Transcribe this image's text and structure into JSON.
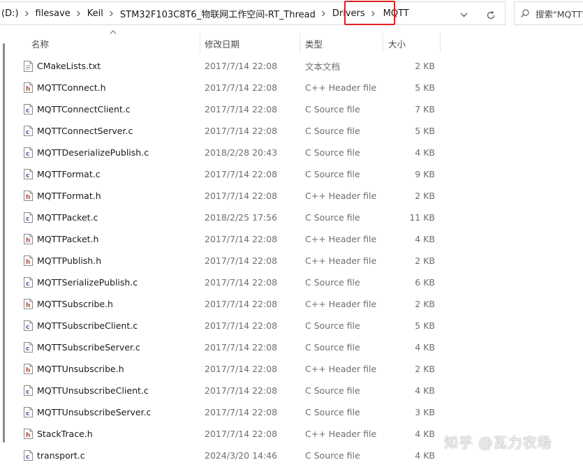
{
  "address_bar": {
    "breadcrumbs": [
      "(D:)",
      "filesave",
      "Keil",
      "STM32F103C8T6_物联网工作空间-RT_Thread",
      "Drivers"
    ],
    "current": "MQTT"
  },
  "search": {
    "placeholder": "搜索\"MQTT\""
  },
  "columns": {
    "name": "名称",
    "date": "修改日期",
    "type": "类型",
    "size": "大小"
  },
  "files": [
    {
      "name": "CMakeLists.txt",
      "date": "2017/7/14 22:08",
      "type": "文本文档",
      "size": "2 KB",
      "icon": "text-file-icon"
    },
    {
      "name": "MQTTConnect.h",
      "date": "2017/7/14 22:08",
      "type": "C++ Header file",
      "size": "5 KB",
      "icon": "header-file-icon"
    },
    {
      "name": "MQTTConnectClient.c",
      "date": "2017/7/14 22:08",
      "type": "C Source file",
      "size": "7 KB",
      "icon": "c-source-icon"
    },
    {
      "name": "MQTTConnectServer.c",
      "date": "2017/7/14 22:08",
      "type": "C Source file",
      "size": "5 KB",
      "icon": "c-source-icon"
    },
    {
      "name": "MQTTDeserializePublish.c",
      "date": "2018/2/28 20:43",
      "type": "C Source file",
      "size": "4 KB",
      "icon": "c-source-icon"
    },
    {
      "name": "MQTTFormat.c",
      "date": "2017/7/14 22:08",
      "type": "C Source file",
      "size": "9 KB",
      "icon": "c-source-icon"
    },
    {
      "name": "MQTTFormat.h",
      "date": "2017/7/14 22:08",
      "type": "C++ Header file",
      "size": "2 KB",
      "icon": "header-file-icon"
    },
    {
      "name": "MQTTPacket.c",
      "date": "2018/2/25 17:56",
      "type": "C Source file",
      "size": "11 KB",
      "icon": "c-source-icon"
    },
    {
      "name": "MQTTPacket.h",
      "date": "2017/7/14 22:08",
      "type": "C++ Header file",
      "size": "4 KB",
      "icon": "header-file-icon"
    },
    {
      "name": "MQTTPublish.h",
      "date": "2017/7/14 22:08",
      "type": "C++ Header file",
      "size": "2 KB",
      "icon": "header-file-icon"
    },
    {
      "name": "MQTTSerializePublish.c",
      "date": "2017/7/14 22:08",
      "type": "C Source file",
      "size": "6 KB",
      "icon": "c-source-icon"
    },
    {
      "name": "MQTTSubscribe.h",
      "date": "2017/7/14 22:08",
      "type": "C++ Header file",
      "size": "2 KB",
      "icon": "header-file-icon"
    },
    {
      "name": "MQTTSubscribeClient.c",
      "date": "2017/7/14 22:08",
      "type": "C Source file",
      "size": "5 KB",
      "icon": "c-source-icon"
    },
    {
      "name": "MQTTSubscribeServer.c",
      "date": "2017/7/14 22:08",
      "type": "C Source file",
      "size": "4 KB",
      "icon": "c-source-icon"
    },
    {
      "name": "MQTTUnsubscribe.h",
      "date": "2017/7/14 22:08",
      "type": "C++ Header file",
      "size": "2 KB",
      "icon": "header-file-icon"
    },
    {
      "name": "MQTTUnsubscribeClient.c",
      "date": "2017/7/14 22:08",
      "type": "C Source file",
      "size": "4 KB",
      "icon": "c-source-icon"
    },
    {
      "name": "MQTTUnsubscribeServer.c",
      "date": "2017/7/14 22:08",
      "type": "C Source file",
      "size": "3 KB",
      "icon": "c-source-icon"
    },
    {
      "name": "StackTrace.h",
      "date": "2017/7/14 22:08",
      "type": "C++ Header file",
      "size": "4 KB",
      "icon": "header-file-icon"
    },
    {
      "name": "transport.c",
      "date": "2024/3/20 14:46",
      "type": "C Source file",
      "size": "4 KB",
      "icon": "c-source-icon"
    }
  ],
  "watermark": "知乎 @瓦力农场",
  "colors": {
    "highlight": "#e01f1f",
    "header_icon": "#b5473a",
    "c_icon": "#4a5a9c"
  }
}
